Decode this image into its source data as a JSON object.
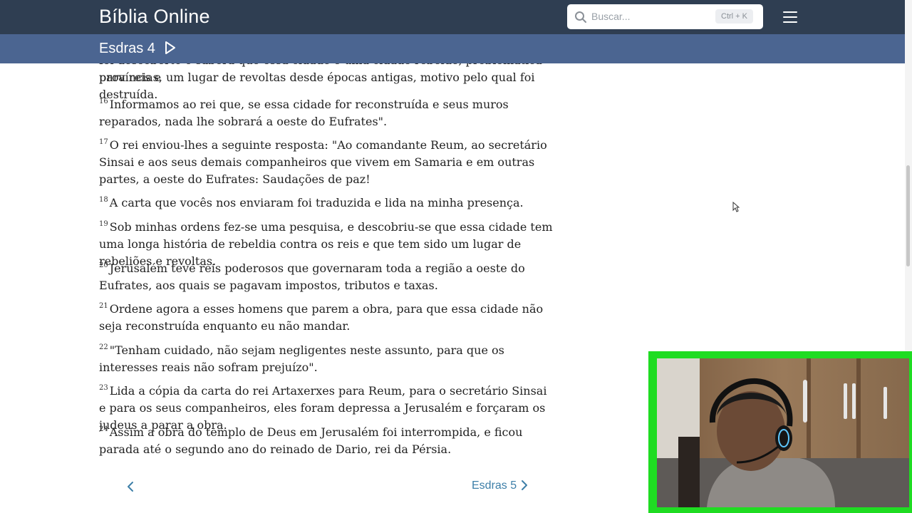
{
  "header": {
    "brand": "Bíblia Online",
    "search_placeholder": "Buscar...",
    "search_shortcut": "Ctrl + K"
  },
  "subheader": {
    "chapter": "Esdras 4"
  },
  "verses": [
    {
      "n": "",
      "text": "foi descoberto o saberá que essa cidade é uma cidade rebelde, problemática para reis e"
    },
    {
      "n": "",
      "text": "províncias, um lugar de revoltas desde épocas antigas, motivo pelo qual foi destruída."
    },
    {
      "n": "16",
      "text": "Informamos ao rei que, se essa cidade for reconstruída e seus muros reparados, nada lhe sobrará a oeste do Eufrates\"."
    },
    {
      "n": "17",
      "text": "O rei enviou-lhes a seguinte resposta: \"Ao comandante Reum, ao secretário Sinsai e aos seus demais companheiros que vivem em Samaria e em outras partes, a oeste do Eufrates: Saudações de paz!"
    },
    {
      "n": "18",
      "text": "A carta que vocês nos enviaram foi traduzida e lida na minha presença."
    },
    {
      "n": "19",
      "text": "Sob minhas ordens fez-se uma pesquisa, e descobriu-se que essa cidade tem uma longa história de rebeldia contra os reis e que tem sido um lugar de rebeliões e revoltas."
    },
    {
      "n": "20",
      "text": "Jerusalém teve reis poderosos que governaram toda a região a oeste do Eufrates, aos quais se pagavam impostos, tributos e taxas."
    },
    {
      "n": "21",
      "text": "Ordene agora a esses homens que parem a obra, para que essa cidade não seja reconstruída enquanto eu não mandar."
    },
    {
      "n": "22",
      "text": "\"Tenham cuidado, não sejam negligentes neste assunto, para que os interesses reais não sofram prejuízo\"."
    },
    {
      "n": "23",
      "text": "Lida a cópia da carta do rei Artaxerxes para Reum, para o secretário Sinsai e para os seus companheiros, eles foram depressa a Jerusalém e forçaram os judeus a parar a obra."
    },
    {
      "n": "24",
      "text": "Assim a obra do templo de Deus em Jerusalém foi interrompida, e ficou parada até o segundo ano do reinado de Dario, rei da Pérsia."
    }
  ],
  "nav": {
    "next_label": "Esdras 5"
  },
  "colors": {
    "header_bg": "#2f3e52",
    "subheader_bg": "#4b6591",
    "link": "#3d7fa8",
    "webcam_border": "#1fdc22"
  }
}
